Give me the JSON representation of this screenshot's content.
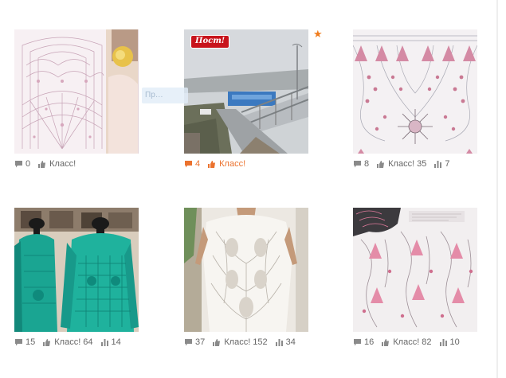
{
  "colors": {
    "accent": "#eb722e",
    "badge": "#c8141c",
    "meta_text": "#666666"
  },
  "tiles": [
    {
      "name": "doily-chart-photo",
      "comments": "0",
      "klass_label": "Класс!",
      "klass_count": "",
      "views": "",
      "active": false
    },
    {
      "name": "station-street-photo",
      "badge": "Пост!",
      "comments": "4",
      "klass_label": "Класс!",
      "klass_count": "",
      "views": "",
      "active": true
    },
    {
      "name": "pineapple-pattern-chart",
      "comments": "8",
      "klass_label": "Класс!",
      "klass_count": "35",
      "views": "7",
      "active": false
    },
    {
      "name": "teal-sweater-photo",
      "comments": "15",
      "klass_label": "Класс!",
      "klass_count": "64",
      "views": "14",
      "active": false
    },
    {
      "name": "white-lace-top-photo",
      "comments": "37",
      "klass_label": "Класс!",
      "klass_count": "152",
      "views": "34",
      "active": false
    },
    {
      "name": "lace-top-schema-page",
      "comments": "16",
      "klass_label": "Класс!",
      "klass_count": "82",
      "views": "10",
      "active": false
    }
  ],
  "ghost_tooltip": "Пр…",
  "icons": {
    "comment": "comment-icon",
    "klass": "thumbs-up-icon",
    "views": "bar-chart-icon",
    "star": "star-icon"
  }
}
